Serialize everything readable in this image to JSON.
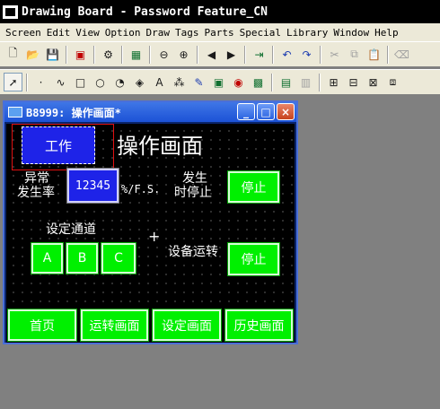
{
  "app": {
    "title": "Drawing Board - Password Feature_CN"
  },
  "menu": [
    "Screen",
    "Edit",
    "View",
    "Option",
    "Draw",
    "Tags",
    "Parts",
    "Special",
    "Library",
    "Window",
    "Help"
  ],
  "toolbar1": [
    "new-icon",
    "open-icon",
    "save-icon",
    "delete-icon",
    "settings-icon",
    "screen-icon",
    "zoom-out-icon",
    "zoom-in-icon",
    "prev-icon",
    "next-icon",
    "exit-icon",
    "undo-icon",
    "redo-icon",
    "cut-icon",
    "copy-icon",
    "paste-icon",
    "clear-icon"
  ],
  "toolbar2": [
    "pointer-icon",
    "dot-icon",
    "polyline-icon",
    "rectangle-icon",
    "circle-icon",
    "arc-icon",
    "fill-icon",
    "text-icon",
    "pattern-icon",
    "pen-icon",
    "bitmap-icon",
    "lamp-icon",
    "picture-icon",
    "parts-icon",
    "library-icon",
    "group-icon",
    "ungroup-icon",
    "align-icon",
    "order-icon"
  ],
  "child_window": {
    "title": "B8999: 操作画面*",
    "buttons": {
      "minimize": "_",
      "maximize": "□",
      "close": "×"
    }
  },
  "hmi": {
    "work_button": "工作",
    "screen_title": "操作画面",
    "abnormal_label_line1": "异常",
    "abnormal_label_line2": "发生率",
    "numeric_value": "12345",
    "unit": "%/F.S.",
    "stop_on_label_line1": "发生",
    "stop_on_label_line2": "时停止",
    "stop_button_1": "停止",
    "channel_label": "设定通道",
    "channels": [
      "A",
      "B",
      "C"
    ],
    "device_running_label": "设备运转",
    "stop_button_2": "停止",
    "nav": [
      "首页",
      "运转画面",
      "设定画面",
      "历史画面"
    ]
  },
  "colors": {
    "hmi_background": "#000000",
    "button_green": "#00f000",
    "numeric_blue": "#1e23e8",
    "selection_red": "#e01010"
  }
}
